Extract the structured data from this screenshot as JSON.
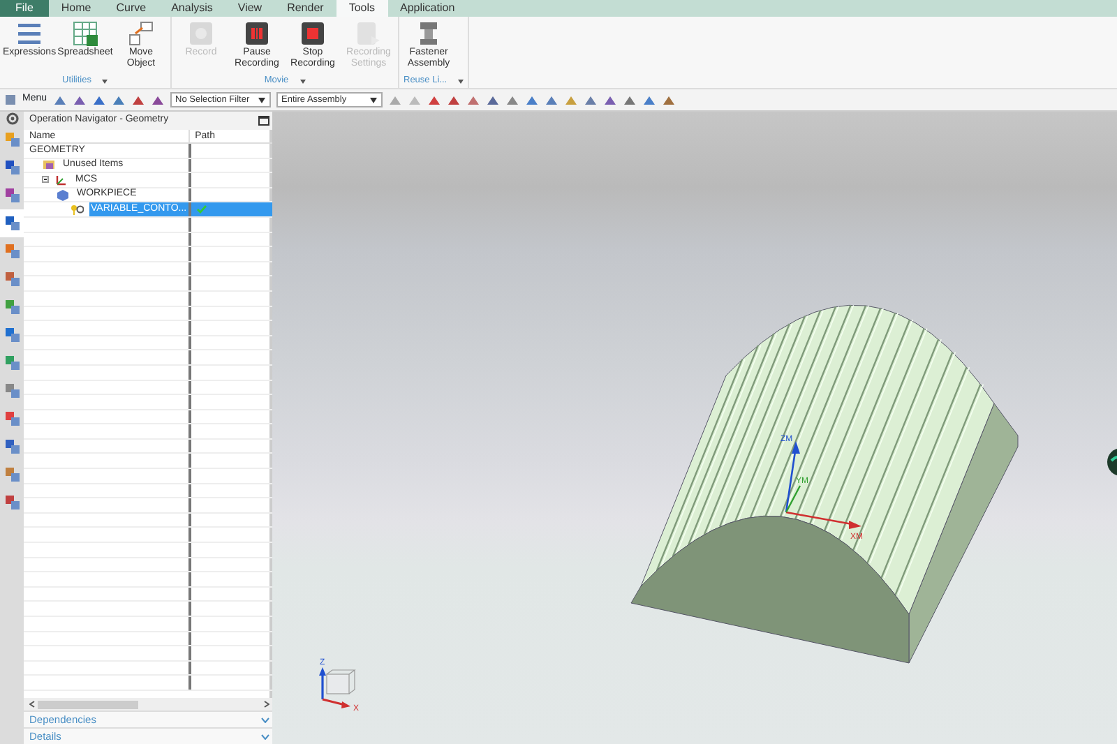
{
  "menu_tabs": [
    {
      "label": "File",
      "kind": "file",
      "selected": false
    },
    {
      "label": "Home",
      "kind": "tab",
      "selected": false
    },
    {
      "label": "Curve",
      "kind": "tab",
      "selected": false
    },
    {
      "label": "Analysis",
      "kind": "tab",
      "selected": false
    },
    {
      "label": "View",
      "kind": "tab",
      "selected": false
    },
    {
      "label": "Render",
      "kind": "tab",
      "selected": false
    },
    {
      "label": "Tools",
      "kind": "tab",
      "selected": true
    },
    {
      "label": "Application",
      "kind": "tab",
      "selected": false
    }
  ],
  "ribbon_groups": [
    {
      "label": "Utilities",
      "buttons": [
        {
          "label": "Expressions",
          "kind": "expressions",
          "disabled": false
        },
        {
          "label": "Spreadsheet",
          "kind": "spreadsheet",
          "disabled": false
        },
        {
          "label": "Move Object",
          "kind": "move",
          "disabled": false
        }
      ]
    },
    {
      "label": "Movie",
      "buttons": [
        {
          "label": "Record",
          "kind": "record",
          "disabled": true
        },
        {
          "label": "Pause Recording",
          "kind": "pause",
          "disabled": false
        },
        {
          "label": "Stop Recording",
          "kind": "stop",
          "disabled": false
        },
        {
          "label": "Recording Settings",
          "kind": "settings",
          "disabled": true
        }
      ]
    },
    {
      "label": "Reuse Li...",
      "buttons": [
        {
          "label": "Fastener Assembly",
          "kind": "fastener",
          "disabled": false
        }
      ]
    }
  ],
  "toolbar": {
    "menu_button": "Menu",
    "selection_filter": "No Selection Filter",
    "assembly_scope": "Entire Assembly"
  },
  "resource_bar": {
    "tabs": [
      {
        "selected": false
      },
      {
        "selected": false
      },
      {
        "selected": false
      },
      {
        "selected": true
      },
      {
        "selected": false
      },
      {
        "selected": false
      },
      {
        "selected": false
      },
      {
        "selected": false
      },
      {
        "selected": false
      },
      {
        "selected": false
      },
      {
        "selected": false
      },
      {
        "selected": false
      },
      {
        "selected": false
      },
      {
        "selected": false
      }
    ]
  },
  "navigator": {
    "title": "Operation Navigator - Geometry",
    "columns": [
      "Name",
      "Path"
    ],
    "tree": [
      {
        "name": "GEOMETRY",
        "kind": "root",
        "selected": false,
        "path_ok": false,
        "children": [
          {
            "name": "Unused Items",
            "kind": "folder",
            "selected": false,
            "path_ok": false
          },
          {
            "name": "MCS",
            "kind": "mcs",
            "selected": false,
            "path_ok": false,
            "children": [
              {
                "name": "WORKPIECE",
                "kind": "workpiece",
                "selected": false,
                "path_ok": false,
                "children": [
                  {
                    "name": "VARIABLE_CONTO...",
                    "kind": "operation",
                    "selected": true,
                    "path_ok": true
                  }
                ]
              }
            ]
          }
        ]
      }
    ],
    "panels": [
      {
        "label": "Dependencies",
        "expanded": false
      },
      {
        "label": "Details",
        "expanded": false
      }
    ]
  },
  "viewport": {
    "part_axes": [
      "ZM",
      "YM",
      "XM"
    ],
    "view_triad_axes": [
      "Z",
      "X"
    ]
  }
}
